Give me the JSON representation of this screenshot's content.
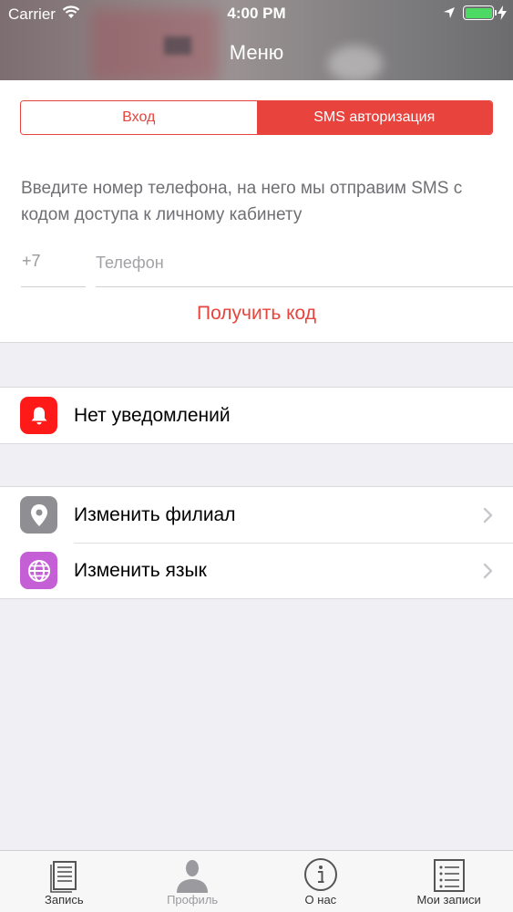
{
  "status_bar": {
    "carrier": "Carrier",
    "time": "4:00 PM"
  },
  "nav": {
    "title": "Меню"
  },
  "auth": {
    "segments": [
      "Вход",
      "SMS авторизация"
    ],
    "selected_segment": "SMS авторизация",
    "instruction": "Введите номер телефона, на него мы отправим SMS с кодом доступа к личному кабинету",
    "country_code": "+7",
    "phone_placeholder": "Телефон",
    "phone_value": "",
    "get_code_label": "Получить код"
  },
  "notifications": {
    "label": "Нет уведомлений",
    "icon": "bell-icon",
    "icon_color": "#ff1a1a"
  },
  "settings": {
    "items": [
      {
        "label": "Изменить филиал",
        "icon": "location-pin-icon",
        "icon_color": "#8e8e93"
      },
      {
        "label": "Изменить язык",
        "icon": "globe-icon",
        "icon_color": "#c45fd6"
      }
    ]
  },
  "tabbar": {
    "tabs": [
      {
        "label": "Запись",
        "icon": "document-icon"
      },
      {
        "label": "Профиль",
        "icon": "person-icon",
        "active": true
      },
      {
        "label": "О нас",
        "icon": "info-icon"
      },
      {
        "label": "Мои записи",
        "icon": "list-icon"
      }
    ]
  },
  "colors": {
    "accent": "#e8433d",
    "background": "#efeff4"
  }
}
